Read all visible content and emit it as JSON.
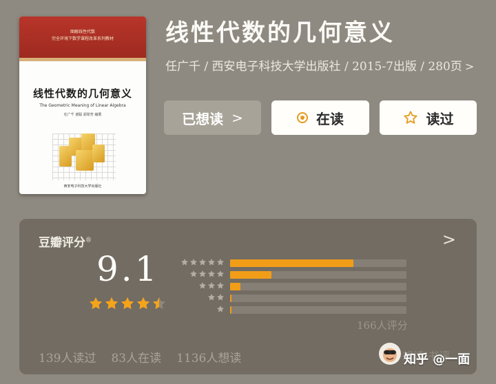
{
  "book": {
    "title": "线性代数的几何意义",
    "meta": "任广千 / 西安电子科技大学出版社 / 2015-7出版 / 280页",
    "meta_chevron": ">"
  },
  "cover": {
    "series_line1": "图解线性代数",
    "series_line2": "完全环境下数学课程改革系列教材",
    "title": "线性代数的几何意义",
    "subtitle": "The Geometric Meaning of Linear Algebra",
    "authors": "任广千  谢聪  胡翠芳  编著",
    "publisher": "西安电子科技大学出版社"
  },
  "actions": {
    "wished_label": "已想读",
    "wished_chevron": ">",
    "reading_label": "在读",
    "read_label": "读过",
    "icons": {
      "reading": "circle-dot-icon",
      "read": "star-outline-icon"
    },
    "accent": "#e69a1c"
  },
  "rating": {
    "label": "豆瓣评分",
    "registered": "®",
    "arrow": ">",
    "score": "9.1",
    "stars_filled": 4.5,
    "distribution": [
      {
        "stars": 5,
        "percent": 69.8
      },
      {
        "stars": 4,
        "percent": 23.5
      },
      {
        "stars": 3,
        "percent": 5.8
      },
      {
        "stars": 2,
        "percent": 0.6
      },
      {
        "stars": 1,
        "percent": 0.3
      }
    ],
    "count": "166人评分",
    "stats": {
      "read": "139人读过",
      "reading": "83人在读",
      "wished": "1136人想读"
    },
    "faded_tabs": "想读   书评"
  },
  "watermark": {
    "text": "知乎 @一面"
  },
  "colors": {
    "background": "#8f8a81",
    "card": "#726c63",
    "bar_fill": "#f29d18",
    "bar_track": "#857f76",
    "big_star": "#f5a419"
  }
}
